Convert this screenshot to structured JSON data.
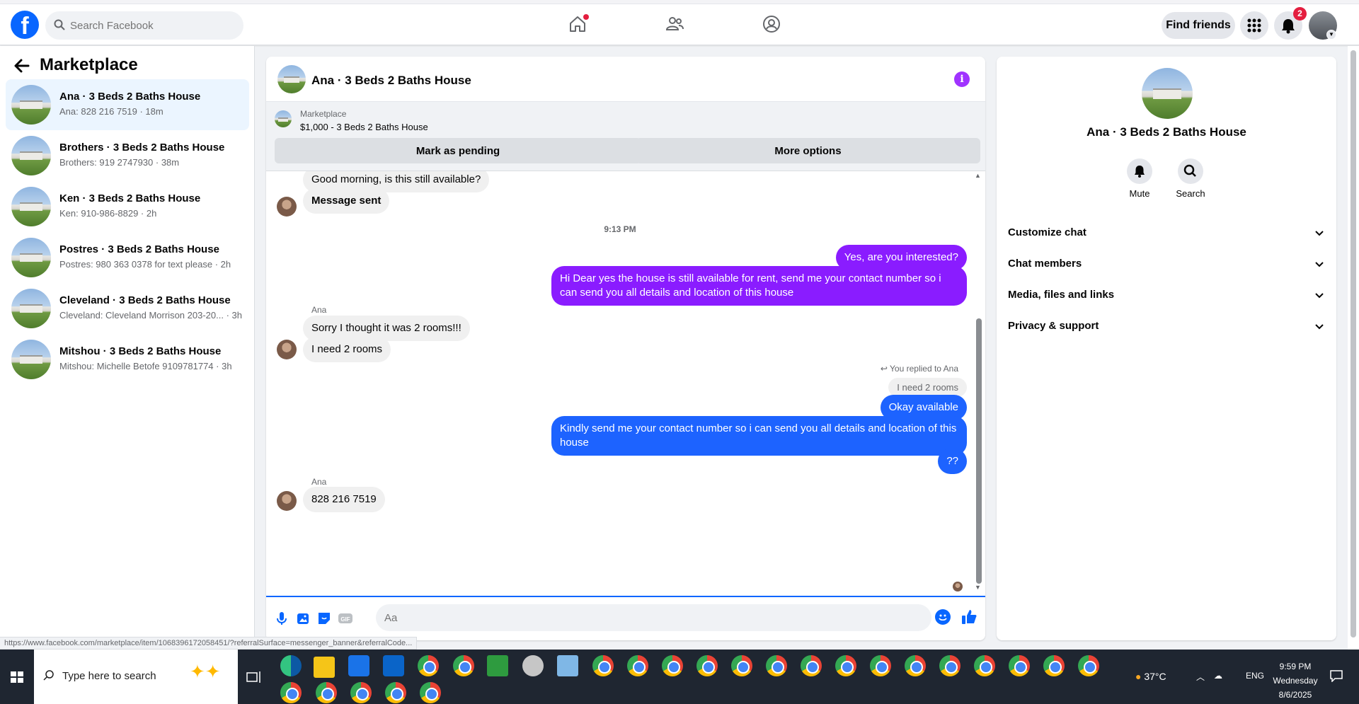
{
  "topbar": {
    "search_placeholder": "Search Facebook",
    "find_friends_label": "Find friends",
    "notifications_count": "2",
    "nav": [
      {
        "icon": "home-icon",
        "has_dot": true
      },
      {
        "icon": "friends-icon"
      },
      {
        "icon": "groups-icon"
      }
    ]
  },
  "sidebar": {
    "title": "Marketplace",
    "conversations": [
      {
        "name": "Ana · 3 Beds 2 Baths House",
        "preview": "Ana: 828 216 7519 · 18m",
        "active": true
      },
      {
        "name": "Brothers · 3 Beds 2 Baths House",
        "preview": "Brothers: 919 2747930 · 38m"
      },
      {
        "name": "Ken · 3 Beds 2 Baths House",
        "preview": "Ken: 910-986-8829 · 2h"
      },
      {
        "name": "Postres · 3 Beds 2 Baths House",
        "preview": "Postres: 980 363 0378 for text please · 2h"
      },
      {
        "name": "Cleveland · 3 Beds 2 Baths House",
        "preview": "Cleveland: Cleveland Morrison 203-20... · 3h"
      },
      {
        "name": "Mitshou · 3 Beds 2 Baths House",
        "preview": "Mitshou: Michelle Betofe 9109781774 · 3h"
      }
    ]
  },
  "chat": {
    "title": "Ana · 3 Beds 2 Baths House",
    "marketplace_label": "Marketplace",
    "listing": "$1,000 - 3 Beds 2 Baths House",
    "mark_pending_label": "Mark as pending",
    "more_options_label": "More options",
    "messages": {
      "m1": "Good morning, is this still available?",
      "m2": "Message sent",
      "time1": "9:13 PM",
      "m3": "Yes, are you interested?",
      "m4": "Hi Dear yes the house is still available for rent, send me your contact number so i can send you all details and location of this house",
      "sender_ana_1": "Ana",
      "m5": "Sorry I thought it was 2 rooms!!!",
      "m6": "I need 2 rooms",
      "replied_label": "You replied to Ana",
      "quoted": "I need 2 rooms",
      "m7": "Okay available",
      "m8": "Kindly  send me your contact number so i can send you all details and location of this house",
      "m9": "??",
      "sender_ana_2": "Ana",
      "m10": "828 216 7519"
    },
    "composer_placeholder": "Aa"
  },
  "right_panel": {
    "name": "Ana · 3 Beds 2 Baths House",
    "mute_label": "Mute",
    "search_label": "Search",
    "sections": [
      "Customize chat",
      "Chat members",
      "Media, files and links",
      "Privacy & support"
    ]
  },
  "status_url": "https://www.facebook.com/marketplace/item/1068396172058451/?referralSurface=messenger_banner&referralCode...",
  "taskbar": {
    "search_text": "Type here to search",
    "weather": "37°C",
    "lang": "ENG",
    "time": "9:59 PM",
    "day": "Wednesday",
    "date": "8/6/2025"
  },
  "colors": {
    "brand": "#0866ff",
    "out_purple": "#8a1cff",
    "out_blue": "#1d63ff",
    "active_conv": "#ebf5ff"
  }
}
